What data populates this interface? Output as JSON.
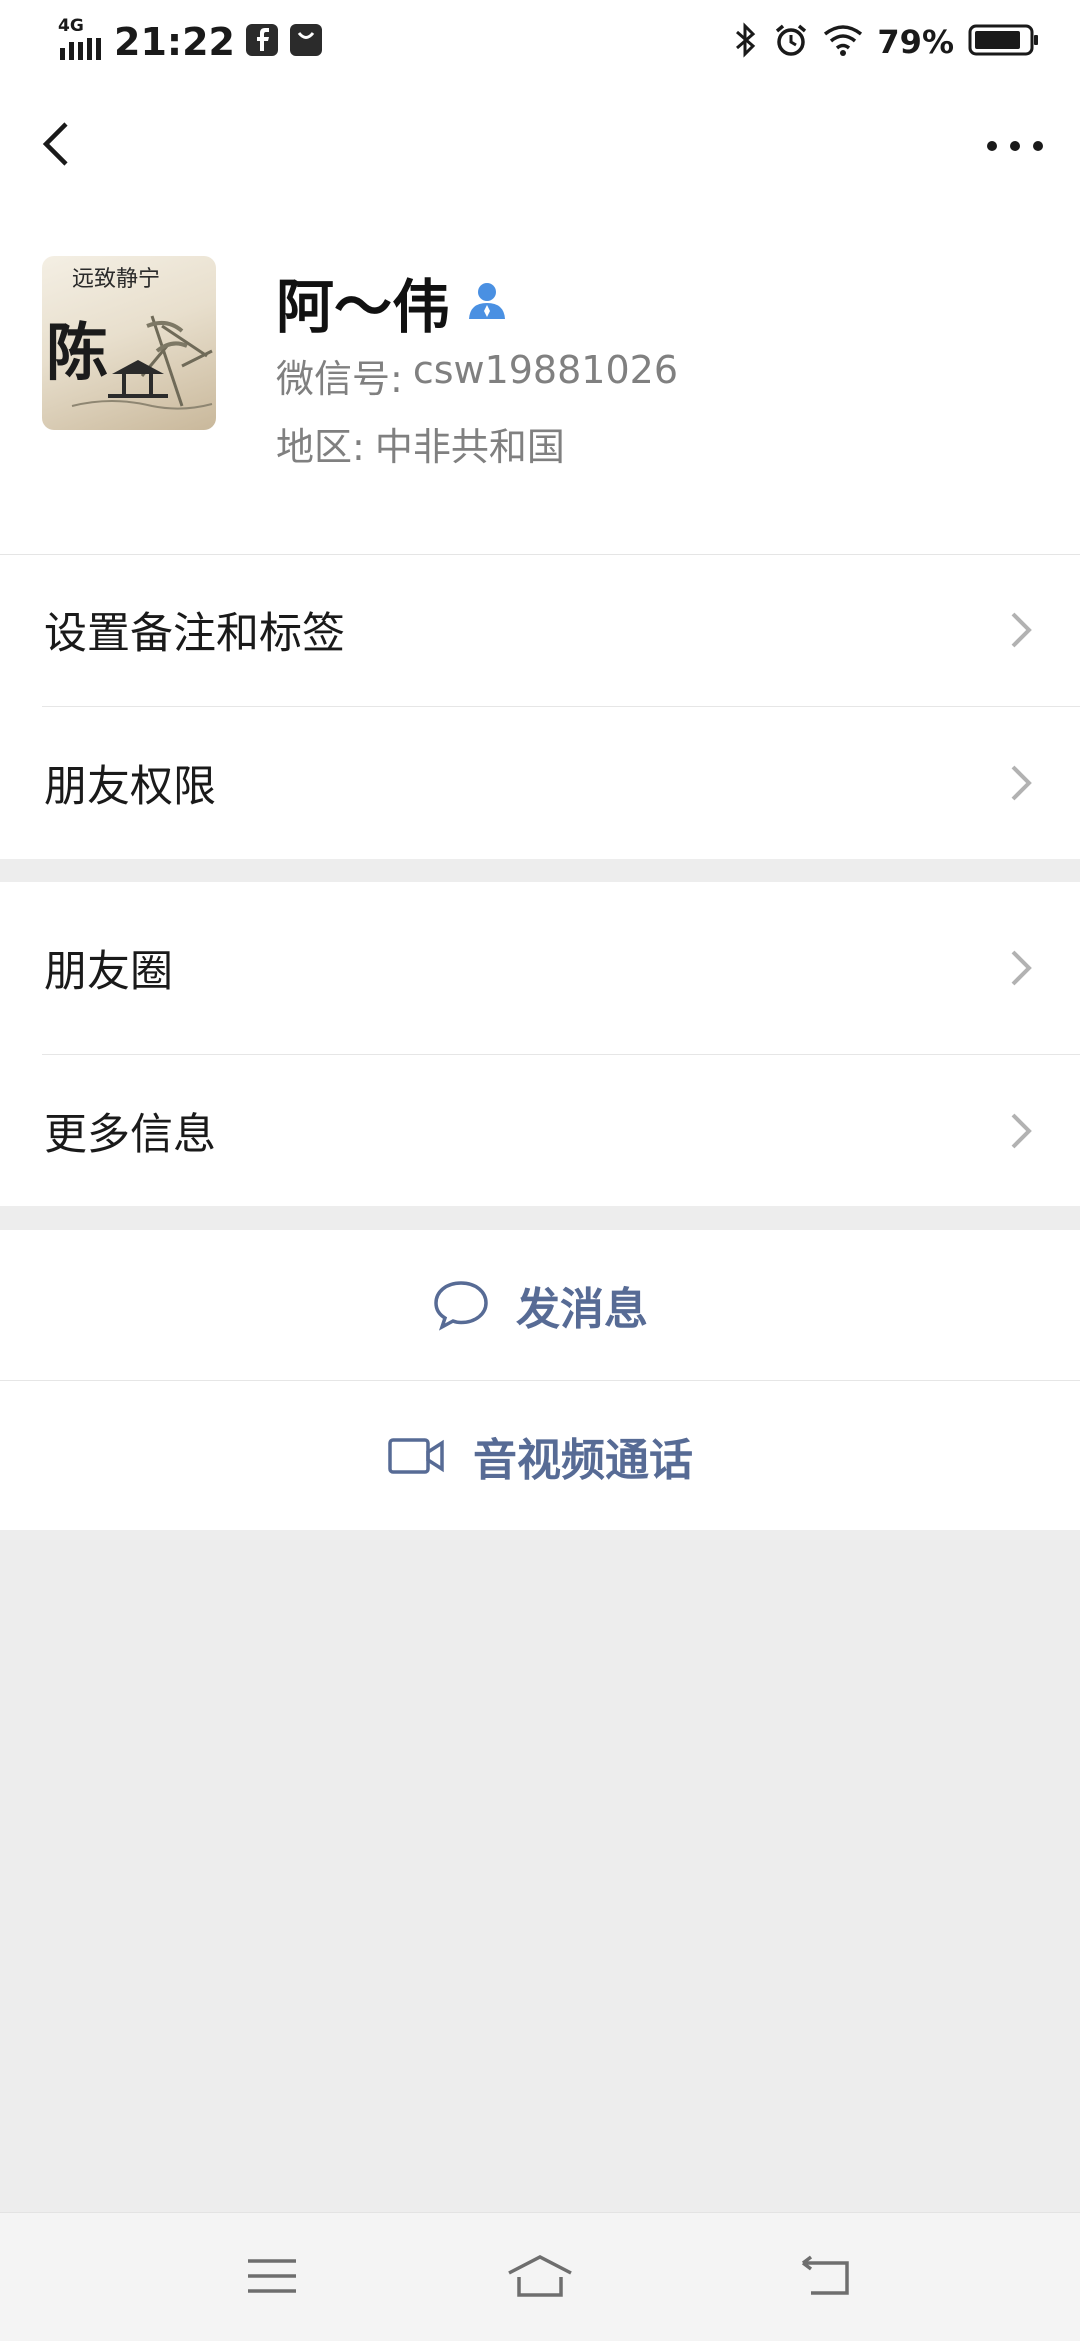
{
  "status_bar": {
    "network": "4G",
    "time": "21:22",
    "battery": "79%",
    "left_icons": [
      "signal-icon",
      "facebook-icon",
      "shopping-bag-icon"
    ],
    "right_icons": [
      "bluetooth-icon",
      "alarm-icon",
      "wifi-icon",
      "battery-icon"
    ]
  },
  "navbar": {
    "back_icon": "chevron-left-icon",
    "more_icon": "more-dots-icon"
  },
  "profile": {
    "nickname": "阿～伟",
    "badge_icon": "person-icon",
    "wechat_id_label": "微信号:",
    "wechat_id": "csw19881026",
    "region_label": "地区:",
    "region": "中非共和国",
    "avatar_calligraphy": "远致静宁",
    "avatar_character": "陈"
  },
  "menu": {
    "section1": [
      {
        "label": "设置备注和标签"
      },
      {
        "label": "朋友权限"
      }
    ],
    "section2": [
      {
        "label": "朋友圈"
      },
      {
        "label": "更多信息"
      }
    ]
  },
  "actions": {
    "send_message": "发消息",
    "video_call": "音视频通话"
  },
  "colors": {
    "link_blue": "#576b95",
    "background": "#ededed",
    "badge_blue": "#4a90e2"
  }
}
